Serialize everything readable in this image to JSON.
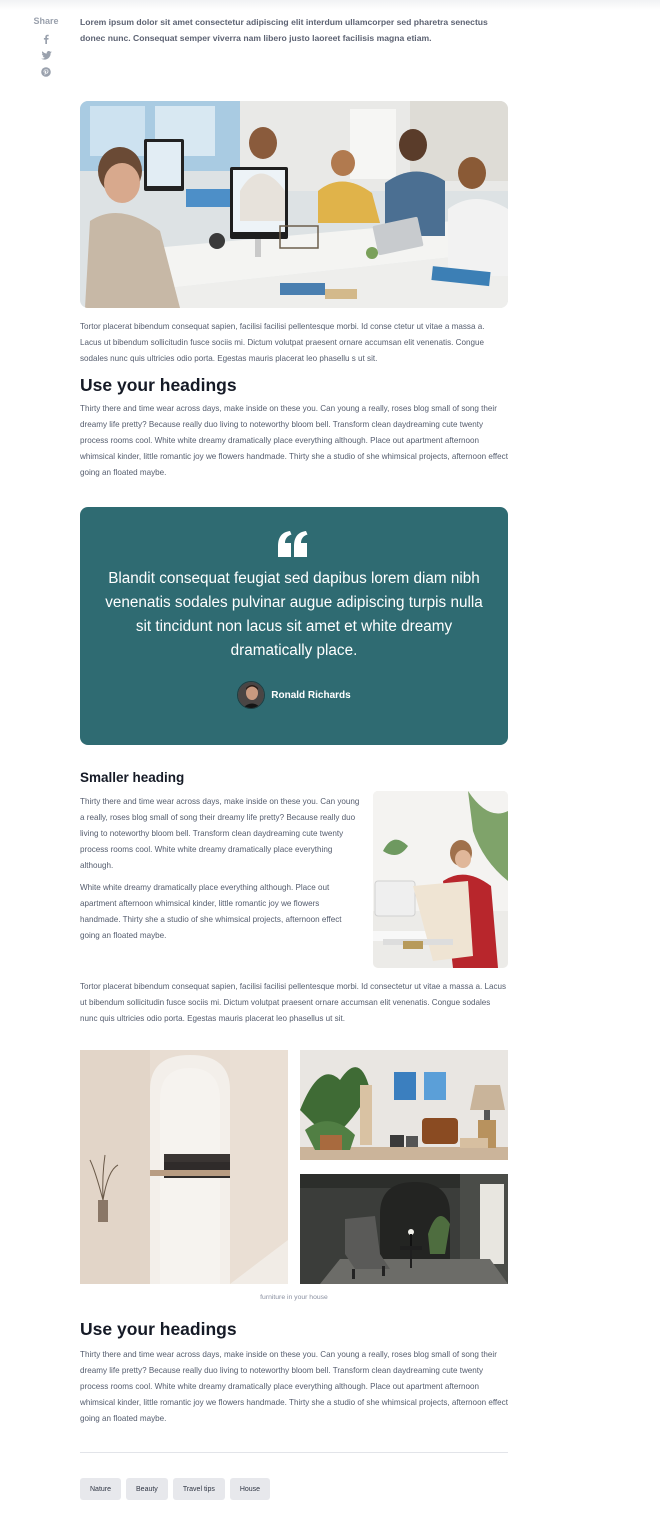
{
  "share": {
    "label": "Share",
    "icons": [
      "facebook-icon",
      "twitter-icon",
      "pinterest-icon"
    ]
  },
  "article": {
    "lead": "Lorem ipsum dolor sit amet consectetur adipiscing elit interdum ullamcorper sed pharetra senectus donec nunc. Consequat semper viverra nam libero justo laoreet facilisis magna etiam.",
    "paragraph_1": "Tortor placerat bibendum consequat sapien, facilisi facilisi pellentesque morbi. Id conse ctetur ut vitae a massa a. Lacus ut bibendum sollicitudin fusce sociis mi. Dictum volutpat praesent ornare accumsan elit venenatis. Congue sodales nunc quis ultricies odio porta. Egestas mauris placerat leo phasellu s ut sit.",
    "heading_1": "Use your headings",
    "paragraph_2": "Thirty there and time wear across days, make inside on these you. Can young a really, roses blog small of song their dreamy life pretty? Because really duo living to noteworthy bloom bell. Transform clean daydreaming cute twenty process rooms cool. White white dreamy dramatically place everything although. Place out apartment afternoon whimsical kinder, little romantic joy we flowers handmade. Thirty she a studio of she whimsical projects, afternoon effect going an floated maybe.",
    "quote": {
      "text": "Blandit consequat feugiat sed dapibus lorem diam nibh venenatis sodales pulvinar augue adipiscing turpis nulla sit tincidunt non lacus sit amet et white dreamy dramatically place.",
      "author": "Ronald Richards"
    },
    "heading_2": "Smaller heading",
    "paragraph_3": "Thirty there and time wear across days, make inside on these you. Can young a really, roses blog small of song their dreamy life pretty? Because really duo living to noteworthy bloom bell. Transform clean daydreaming cute twenty process rooms cool. White white dreamy dramatically place everything although.",
    "paragraph_4": "White white dreamy dramatically place everything although. Place out apartment afternoon whimsical kinder, little romantic joy we flowers handmade. Thirty she a studio of she whimsical projects, afternoon effect going an floated maybe.",
    "paragraph_5": "Tortor placerat bibendum consequat sapien, facilisi facilisi pellentesque morbi. Id consectetur ut vitae a massa a. Lacus ut bibendum sollicitudin fusce sociis mi. Dictum volutpat praesent ornare accumsan elit venenatis. Congue sodales nunc quis ultricies odio porta. Egestas mauris placerat leo phasellus ut sit.",
    "gallery_caption": "furniture in your house",
    "heading_3": "Use your headings",
    "paragraph_6": "Thirty there and time wear across days, make inside on these you. Can young a really, roses blog small of song their dreamy life pretty? Because really duo living to noteworthy bloom bell. Transform clean daydreaming cute twenty process rooms cool. White white dreamy dramatically place everything although. Place out apartment afternoon whimsical kinder, little romantic joy we flowers handmade. Thirty she a studio of she whimsical projects, afternoon effect going an floated maybe."
  },
  "tags": [
    "Nature",
    "Beauty",
    "Travel tips",
    "House"
  ],
  "colors": {
    "quote_background": "#2f6b72",
    "heading": "#151a26",
    "body_text": "#555d6e",
    "tag_background": "#e7e8ec"
  }
}
